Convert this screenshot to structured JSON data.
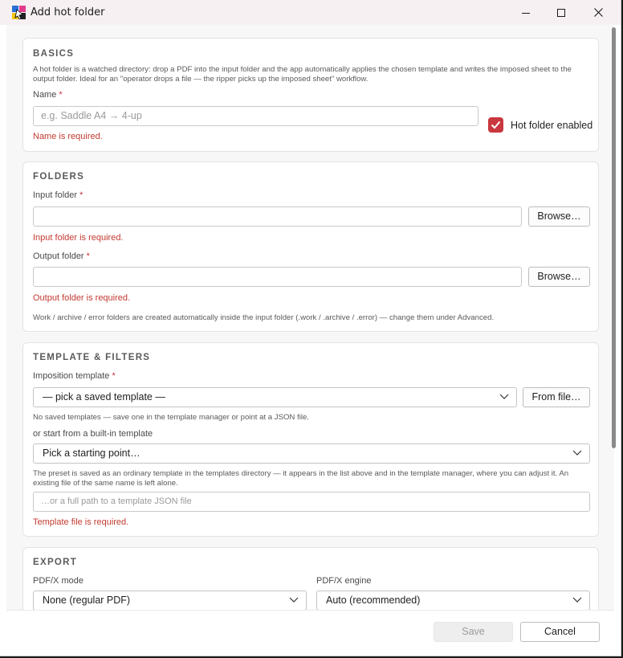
{
  "window": {
    "title": "Add hot folder"
  },
  "basics": {
    "section_title": "BASICS",
    "description": "A hot folder is a watched directory: drop a PDF into the input folder and the app automatically applies the chosen template and writes the imposed sheet to the output folder. Ideal for an \"operator drops a file — the ripper picks up the imposed sheet\" workflow.",
    "name_label": "Name",
    "name_placeholder": "e.g. Saddle A4 → 4-up",
    "name_value": "",
    "name_error": "Name is required.",
    "enabled_label": "Hot folder enabled",
    "enabled_checked": true
  },
  "folders": {
    "section_title": "FOLDERS",
    "input_label": "Input folder",
    "input_value": "",
    "input_browse": "Browse…",
    "input_error": "Input folder is required.",
    "output_label": "Output folder",
    "output_value": "",
    "output_browse": "Browse…",
    "output_error": "Output folder is required.",
    "note": "Work / archive / error folders are created automatically inside the input folder (.work / .archive / .error) — change them under Advanced."
  },
  "template": {
    "section_title": "TEMPLATE & FILTERS",
    "imposition_label": "Imposition template",
    "imposition_selected": "— pick a saved template —",
    "from_file": "From file…",
    "no_saved_note": "No saved templates — save one in the template manager or point at a JSON file.",
    "builtin_label": "or start from a built-in template",
    "builtin_selected": "Pick a starting point…",
    "preset_note": "The preset is saved as an ordinary template in the templates directory — it appears in the list above and in the template manager, where you can adjust it. An existing file of the same name is left alone.",
    "path_placeholder": "…or a full path to a template JSON file",
    "path_error": "Template file is required."
  },
  "export": {
    "section_title": "EXPORT",
    "pdfx_mode_label": "PDF/X mode",
    "pdfx_mode_selected": "None (regular PDF)",
    "pdfx_engine_label": "PDF/X engine",
    "pdfx_engine_selected": "Auto (recommended)"
  },
  "footer": {
    "save": "Save",
    "cancel": "Cancel"
  },
  "colors": {
    "accent": "#c9373f",
    "error": "#c23a30"
  },
  "required_mark": "*"
}
